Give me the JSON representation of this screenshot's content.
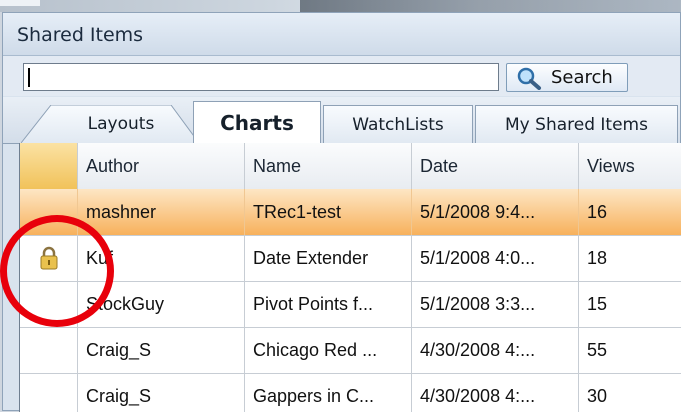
{
  "panel": {
    "title": "Shared Items"
  },
  "search": {
    "value": "",
    "button_label": "Search"
  },
  "tabs": [
    {
      "label": "Layouts",
      "active": false
    },
    {
      "label": "Charts",
      "active": true
    },
    {
      "label": "WatchLists",
      "active": false
    },
    {
      "label": "My Shared Items",
      "active": false
    }
  ],
  "table": {
    "columns": [
      "Author",
      "Name",
      "Date",
      "Views"
    ],
    "rows": [
      {
        "locked": false,
        "selected": true,
        "author": "mashner",
        "name": "TRec1-test",
        "date": "5/1/2008 9:4...",
        "views": "16"
      },
      {
        "locked": true,
        "selected": false,
        "author": "Kuf",
        "name": "Date Extender",
        "date": "5/1/2008 4:0...",
        "views": "18"
      },
      {
        "locked": false,
        "selected": false,
        "author": "StockGuy",
        "name": "Pivot Points f...",
        "date": "5/1/2008 3:3...",
        "views": "15"
      },
      {
        "locked": false,
        "selected": false,
        "author": "Craig_S",
        "name": "Chicago Red ...",
        "date": "4/30/2008 4:...",
        "views": "55"
      },
      {
        "locked": false,
        "selected": false,
        "author": "Craig_S",
        "name": "Gappers in C...",
        "date": "4/30/2008 4:...",
        "views": "30"
      }
    ]
  },
  "annotation": {
    "color": "#e8000b",
    "shape": "circle"
  }
}
